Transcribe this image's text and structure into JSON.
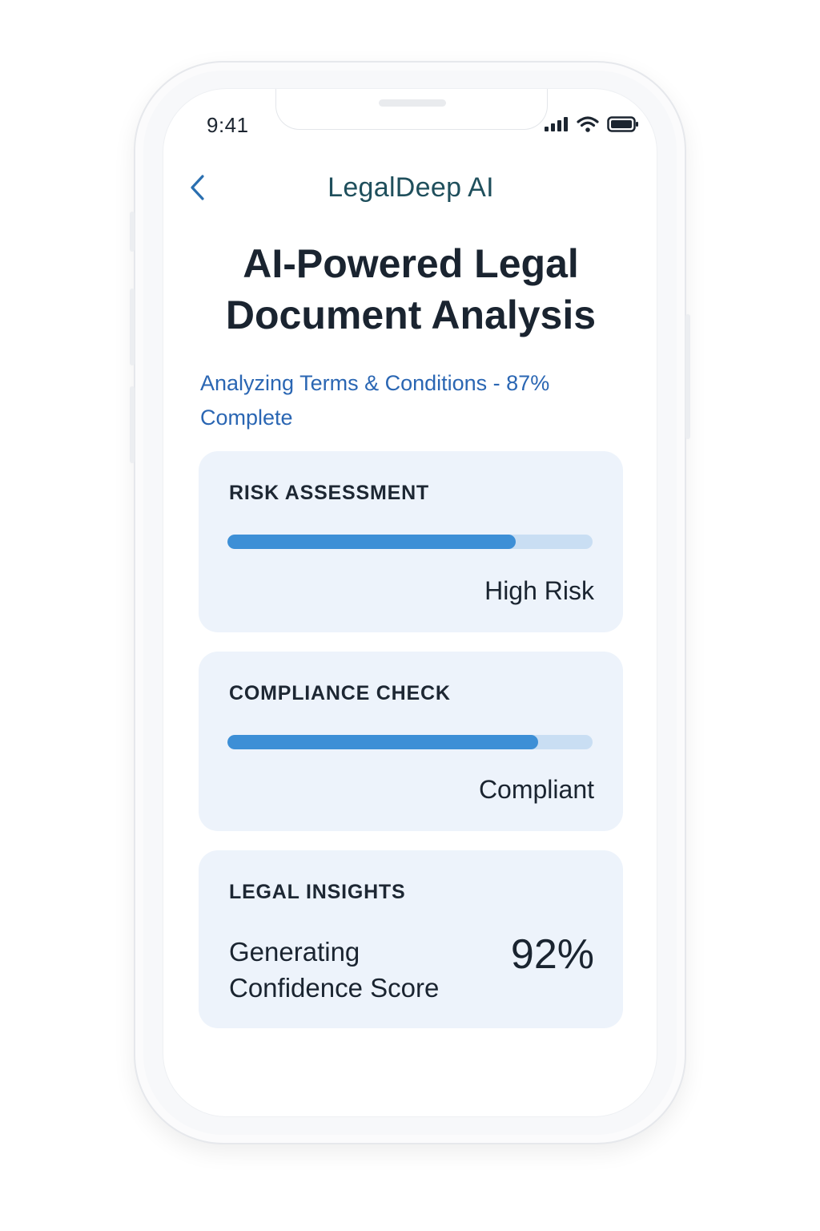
{
  "status_bar": {
    "time": "9:41"
  },
  "nav": {
    "title": "LegalDeep AI"
  },
  "headline": {
    "line1": "AI-Powered Legal",
    "line2": "Document Analysis"
  },
  "progress_text": "Analyzing Terms & Conditions - 87% Complete",
  "cards": {
    "risk": {
      "title": "RISK ASSESSMENT",
      "level_fraction": 0.79,
      "value": "High Risk"
    },
    "compliance": {
      "title": "COMPLIANCE CHECK",
      "level_fraction": 0.85,
      "value": "Compliant"
    },
    "insights": {
      "title": "LEGAL INSIGHTS",
      "label": "Generating Confidence Score",
      "score": "92%"
    }
  },
  "colors": {
    "accent": "#3d8fd6",
    "track": "#c9def3",
    "card_bg": "#edf3fb",
    "link": "#2a66b3",
    "nav_title": "#1f4f5c"
  },
  "icons": {
    "back": "chevron-left-icon",
    "signal": "cellular-signal-icon",
    "wifi": "wifi-icon",
    "battery": "battery-icon"
  }
}
